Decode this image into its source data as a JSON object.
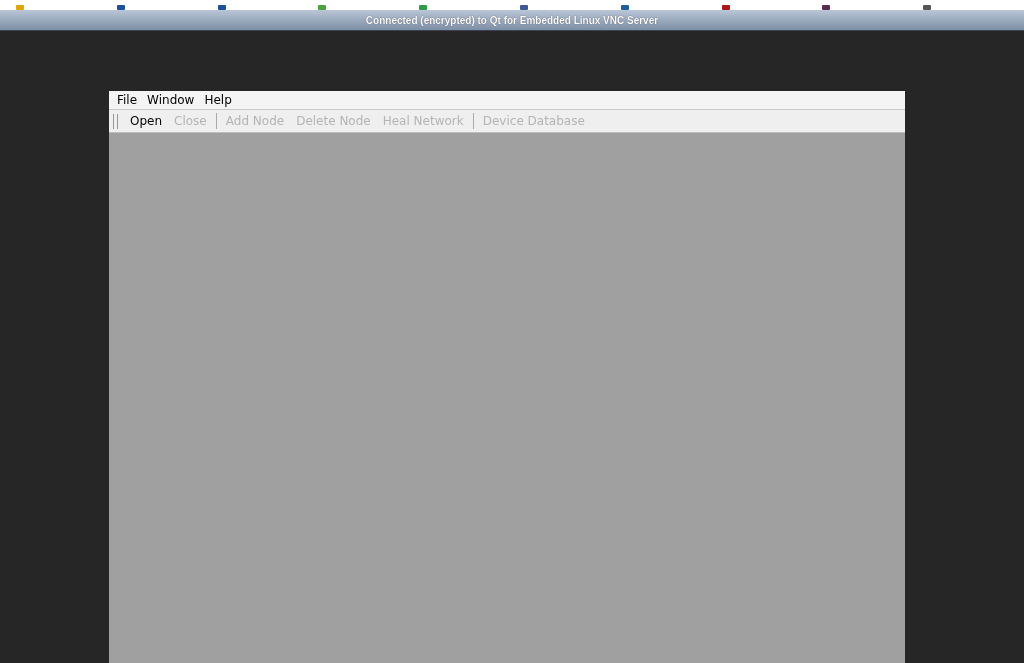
{
  "vnc_bar": {
    "title": "Connected (encrypted) to Qt for Embedded Linux VNC Server"
  },
  "menu": [
    "File",
    "Window",
    "Help"
  ],
  "toolbar_groups": [
    [
      {
        "label": "Open",
        "disabled": false
      },
      {
        "label": "Close",
        "disabled": true
      }
    ],
    [
      {
        "label": "Add Node",
        "disabled": true
      },
      {
        "label": "Delete Node",
        "disabled": true
      },
      {
        "label": "Heal Network",
        "disabled": true
      }
    ],
    [
      {
        "label": "Device Database",
        "disabled": true
      }
    ]
  ]
}
